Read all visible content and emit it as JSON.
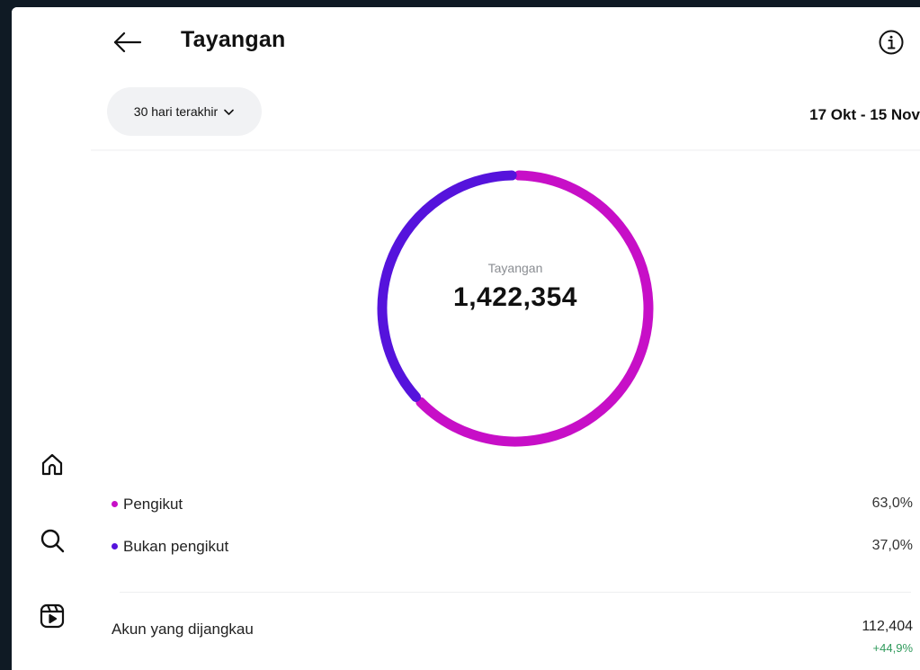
{
  "header": {
    "title": "Tayangan"
  },
  "filter": {
    "range_label": "30 hari terakhir",
    "date_range": "17 Okt - 15 Nov"
  },
  "summary": {
    "label": "Tayangan",
    "total": "1,422,354"
  },
  "breakdown": [
    {
      "label": "Pengikut",
      "percent": "63,0%",
      "color": "#c70fc7",
      "share": 63.0
    },
    {
      "label": "Bukan pengikut",
      "percent": "37,0%",
      "color": "#5513dc",
      "share": 37.0
    }
  ],
  "reach": {
    "label": "Akun yang dijangkau",
    "value": "112,404",
    "change": "+44,9%"
  },
  "nav": {
    "icons": [
      "home-icon",
      "search-icon",
      "reels-icon"
    ]
  },
  "colors": {
    "followers": "#c70fc7",
    "non_followers": "#5513dc",
    "positive": "#2f9a5b"
  }
}
